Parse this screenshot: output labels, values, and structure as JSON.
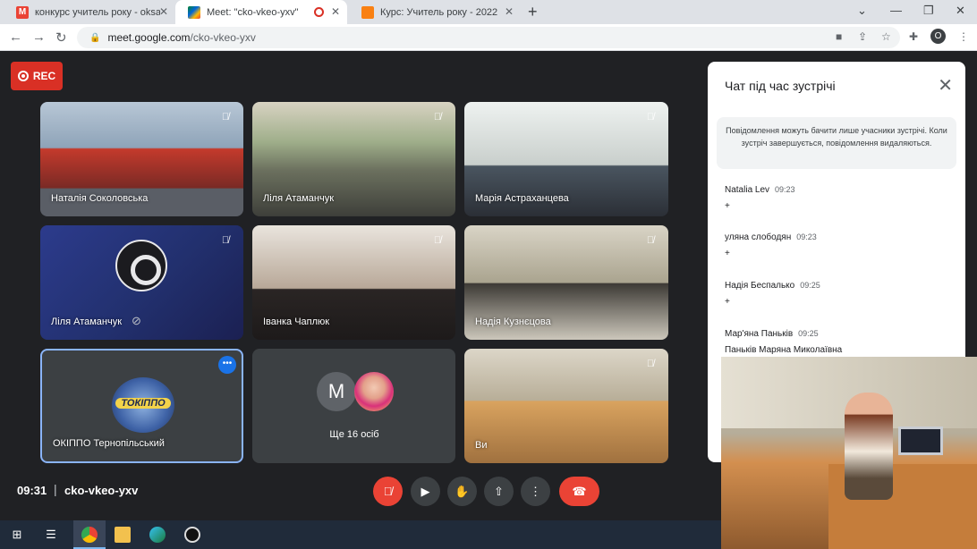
{
  "browser": {
    "tabs": [
      {
        "title": "конкурс учитель року - oksana.",
        "favicon": "gmail-icon",
        "active": false
      },
      {
        "title": "Meet: \"cko-vkeo-yxv\"",
        "favicon": "google-meet-icon",
        "active": true,
        "recording": true
      },
      {
        "title": "Курс: Учитель року - 2022",
        "favicon": "moodle-icon",
        "active": false
      }
    ],
    "url": {
      "host": "meet.google.com",
      "path": "/cko-vkeo-yxv"
    },
    "profile_initial": "O"
  },
  "meet": {
    "rec_label": "REC",
    "tiles": [
      {
        "name": "Наталія Соколовська",
        "muted": true
      },
      {
        "name": "Ліля Атаманчук",
        "muted": true
      },
      {
        "name": "Марія Астраханцева",
        "muted": true
      },
      {
        "name": "Ліля Атаманчук",
        "muted": true,
        "camera_off": true
      },
      {
        "name": "Іванка Чаплюк",
        "muted": true
      },
      {
        "name": "Надія Кузнєцова",
        "muted": true
      },
      {
        "name": "ОКІППО Тернопільський",
        "muted": false,
        "logo_text": "ТОКІППО"
      },
      {
        "name": "",
        "more_count": "Ще 16 осіб",
        "avatar_initial": "M"
      },
      {
        "name": "Ви",
        "muted": true
      }
    ],
    "bottom": {
      "time": "09:31",
      "meeting_code": "cko-vkeo-yxv"
    },
    "chat": {
      "title": "Чат під час зустрічі",
      "notice": "Повідомлення можуть бачити лише учасники зустрічі. Коли зустріч завершується, повідомлення видаляються.",
      "messages": [
        {
          "author": "Natalia Lev",
          "time": "09:23",
          "text": "+"
        },
        {
          "author": "уляна слободян",
          "time": "09:23",
          "text": "+"
        },
        {
          "author": "Надія Беспалько",
          "time": "09:25",
          "text": "+"
        },
        {
          "author": "Мар'яна Паньків",
          "time": "09:25",
          "text": "Паньків Маряна Миколаївна"
        }
      ]
    }
  },
  "colors": {
    "rec": "#d93025",
    "hangup": "#ea4335",
    "accent": "#1a73e8",
    "meet_bg": "#202124"
  }
}
